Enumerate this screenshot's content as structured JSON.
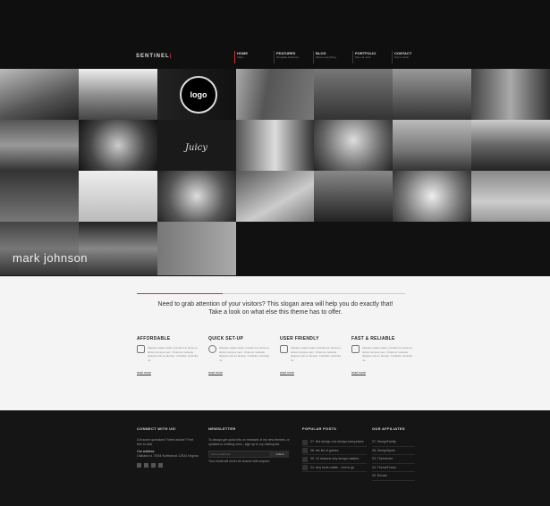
{
  "header": {
    "logo": "SENTINEL",
    "logo_accent": "",
    "nav": [
      {
        "title": "HOME",
        "sub": "Index"
      },
      {
        "title": "FEATURES",
        "sub": "Template Features"
      },
      {
        "title": "BLOG",
        "sub": "About everything"
      },
      {
        "title": "PORTFOLIO",
        "sub": "See our work"
      },
      {
        "title": "CONTACT",
        "sub": "Get in touch"
      }
    ]
  },
  "gallery": {
    "caption": "mark johnson",
    "badge": "logo",
    "sign": "Juicy"
  },
  "slogan": {
    "line1": "Need to grab attention of your visitors? This slogan area will help you do exactly that!",
    "line2": "Take a look on what else this theme has to offer."
  },
  "features": [
    {
      "title": "AFFORDABLE",
      "text": "Aliquam sapien dolor, tincidunt et porta eu, dictum tempus sem. Vivamus molestie aliquam nisi eu laoreet. Curabitur vehicula mi.",
      "link": "read more"
    },
    {
      "title": "QUICK SET-UP",
      "text": "Aliquam sapien dolor, tincidunt et porta eu, dictum tempus sem. Vivamus molestie aliquam nisi eu laoreet. Curabitur vehicula mi.",
      "link": "read more"
    },
    {
      "title": "USER FRIENDLY",
      "text": "Aliquam sapien dolor, tincidunt et porta eu, dictum tempus sem. Vivamus molestie aliquam nisi eu laoreet. Curabitur vehicula mi.",
      "link": "read more"
    },
    {
      "title": "FAST & RELIABLE",
      "text": "Aliquam sapien dolor, tincidunt et porta eu, dictum tempus sem. Vivamus molestie aliquam nisi eu laoreet. Curabitur vehicula mi.",
      "link": "read more"
    }
  ],
  "footer": {
    "connect": {
      "heading": "CONNECT WITH US!",
      "intro": "Got some questions? Need advice? Feel free to ask!",
      "address_label": "Our address:",
      "address": "Oakland st. 75/34 Northwood 12534 Virginia"
    },
    "newsletter": {
      "heading": "NEWSLETTER",
      "text": "To always get quick info on released of my new themes, or updates to existing ones - sign up to my mailing list.",
      "placeholder": "enter email here",
      "button": "submit",
      "note": "Your email will never be shared with anyone."
    },
    "popular": {
      "heading": "POPULAR POSTS",
      "items": [
        {
          "date": "07.",
          "title": "Not design, but design everywhere"
        },
        {
          "date": "08.",
          "title": "the list of games"
        },
        {
          "date": "09.",
          "title": "10 reasons why design matters"
        },
        {
          "date": "04.",
          "title": "why fonts matter - font to go"
        }
      ]
    },
    "affiliates": {
      "heading": "OUR AFFILIATES",
      "items": [
        "07. DesignFamily",
        "08. DesignSpots",
        "09. ThemeLine",
        "04. ThemeForest",
        "05. Envato"
      ]
    }
  }
}
